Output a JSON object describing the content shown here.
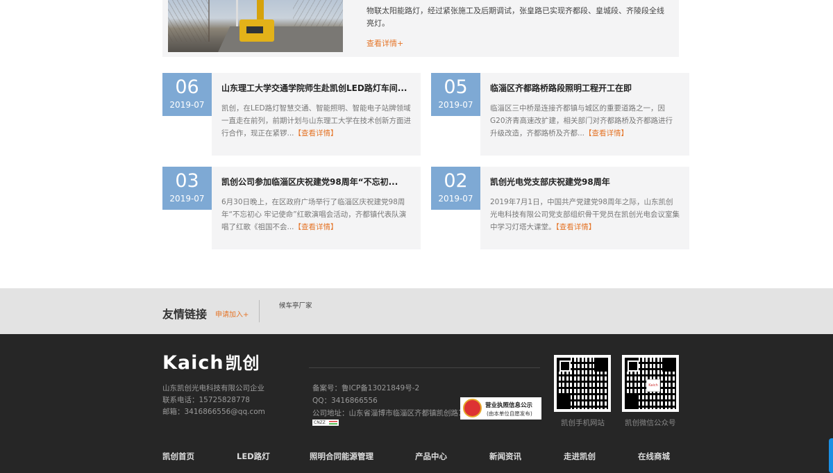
{
  "featured": {
    "text": "物联太阳能路灯，经过紧张施工及后期调试，张皇路已实现齐都段、皇城段、齐陵段全线亮灯。",
    "more": "查看详情+"
  },
  "news": [
    {
      "day": "06",
      "ym": "2019-07",
      "title": "山东理工大学交通学院师生赴凯创LED路灯车间...",
      "desc": "凯创，在LED路灯智慧交通、智能照明、智能电子站牌领域一直走在前列，前期计划与山东理工大学在技术创新方面进行合作，现正在紧锣...",
      "link": "【查看详情】"
    },
    {
      "day": "05",
      "ym": "2019-07",
      "title": "临淄区齐都路桥路段照明工程开工在即",
      "desc": "临淄区三中桥是连接齐都镇与城区的重要道路之一，因G20济青高速改扩建，相关部门对齐都路桥及齐都路进行升级改造，齐都路桥及齐都...",
      "link": "【查看详情】"
    },
    {
      "day": "03",
      "ym": "2019-07",
      "title": "凯创公司参加临淄区庆祝建党98周年“不忘初...",
      "desc": "6月30日晚上，在区政府广场举行了临淄区庆祝建党98周年“不忘初心 牢记使命”红歌演唱会活动，齐都镇代表队演唱了红歌《祖国不会...",
      "link": "【查看详情】"
    },
    {
      "day": "02",
      "ym": "2019-07",
      "title": "凯创光电党支部庆祝建党98周年",
      "desc": "2019年7月1日，中国共产党建党98周年之际，山东凯创光电科技有限公司党支部组织骨干党员在凯创光电会议室集中学习灯塔大课堂。",
      "link": "【查看详情】"
    }
  ],
  "friend": {
    "title": "友情链接",
    "apply": "申请加入+",
    "links": [
      "候车亭厂家"
    ]
  },
  "footer": {
    "logo_en": "Kaich",
    "logo_cn": "凯创",
    "company": "山东凯创光电科技有限公司企业",
    "phone": "联系电话：15725828778",
    "email": "邮箱：3416866556@qq.com",
    "icp": "备案号：鲁ICP备13021849号-2",
    "qq": "QQ：3416866556",
    "address": "公司地址：山东省淄博市临淄区齐都镇凯创路1号",
    "cnzz": "CNZZ",
    "license_title": "营业执照信息公示",
    "license_sub": "(由本单位自愿发布)",
    "qr_center": "Kaich",
    "qr1_label": "凯创手机网站",
    "qr2_label": "凯创微信公众号",
    "nav": [
      "凯创首页",
      "LED路灯",
      "照明合同能源管理",
      "产品中心",
      "新闻资讯",
      "走进凯创",
      "在线商城"
    ]
  },
  "colors": {
    "accent": "#e5762a",
    "date_bg": "#7ea9d4",
    "footer_bg": "#262626",
    "side_tab": "#1b8fe3"
  }
}
